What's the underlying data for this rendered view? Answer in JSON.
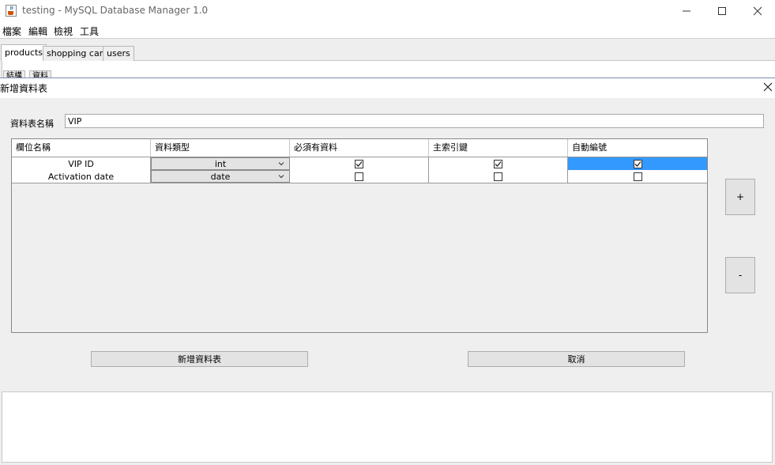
{
  "window": {
    "title": "testing - MySQL Database Manager 1.0",
    "app_icon": "java-cup-icon"
  },
  "menubar": {
    "items": [
      "檔案",
      "編輯",
      "檢視",
      "工具"
    ]
  },
  "tabs": [
    {
      "label": "products",
      "active": true
    },
    {
      "label": "shopping cart",
      "active": false
    },
    {
      "label": "users",
      "active": false
    }
  ],
  "subtabs": [
    "結構",
    "資料"
  ],
  "dialog": {
    "title": "新增資料表",
    "table_name_label": "資料表名稱",
    "table_name_value": "VIP",
    "columns": [
      "欄位名稱",
      "資料類型",
      "必須有資料",
      "主索引鍵",
      "自動編號"
    ],
    "rows": [
      {
        "name": "VIP ID",
        "type": "int",
        "not_null": true,
        "primary_key": true,
        "auto_increment": true
      },
      {
        "name": "Activation date",
        "type": "date",
        "not_null": false,
        "primary_key": false,
        "auto_increment": false
      }
    ],
    "add_row_label": "+",
    "remove_row_label": "-",
    "create_button": "新增資料表",
    "cancel_button": "取消"
  },
  "colors": {
    "selection": "#3399ff",
    "dialog_bg": "#efefef",
    "button_bg": "#e3e3e3"
  }
}
